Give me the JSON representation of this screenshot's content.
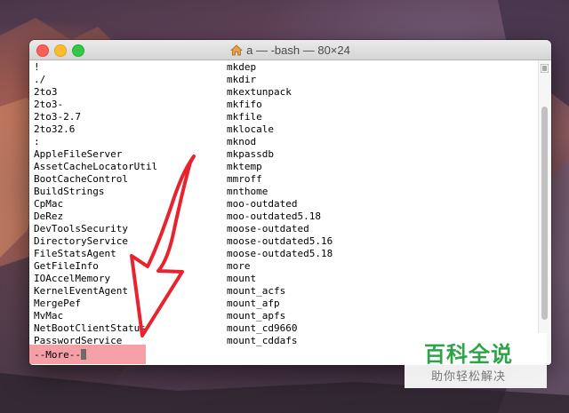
{
  "window": {
    "title": "a — -bash — 80×24",
    "title_icon": "home-folder-icon"
  },
  "terminal": {
    "left_column": [
      "!",
      "./",
      "2to3",
      "2to3-",
      "2to3-2.7",
      "2to32.6",
      ":",
      "AppleFileServer",
      "AssetCacheLocatorUtil",
      "BootCacheControl",
      "BuildStrings",
      "CpMac",
      "DeRez",
      "DevToolsSecurity",
      "DirectoryService",
      "FileStatsAgent",
      "GetFileInfo",
      "IOAccelMemory",
      "KernelEventAgent",
      "MergePef",
      "MvMac",
      "NetBootClientStatus",
      "PasswordService"
    ],
    "right_column": [
      "mkdep",
      "mkdir",
      "mkextunpack",
      "mkfifo",
      "mkfile",
      "mklocale",
      "mknod",
      "mkpassdb",
      "mktemp",
      "mmroff",
      "mnthome",
      "moo-outdated",
      "moo-outdated5.18",
      "moose-outdated",
      "moose-outdated5.16",
      "moose-outdated5.18",
      "more",
      "mount",
      "mount_acfs",
      "mount_afp",
      "mount_apfs",
      "mount_cd9660",
      "mount_cddafs"
    ],
    "pager_prompt": "--More--",
    "highlight_color": "#f4a0a6"
  },
  "annotation": {
    "arrow_color": "#e8232e",
    "arrow_meaning": "points-to-more-prompt"
  },
  "watermark": {
    "title": "百科全说",
    "subtitle": "助你轻松解决",
    "color": "#2fa34a"
  }
}
